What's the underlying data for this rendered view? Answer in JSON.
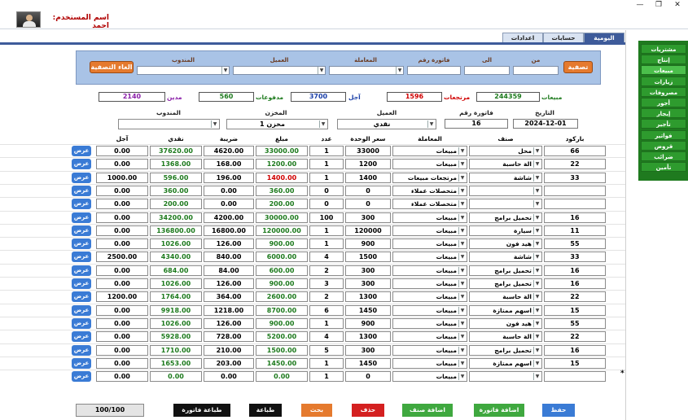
{
  "header": {
    "username_label": "اسم المستخدم: احمد"
  },
  "tabs": [
    {
      "label": "اليومية",
      "active": true
    },
    {
      "label": "حسابات",
      "active": false
    },
    {
      "label": "اعدادات",
      "active": false
    }
  ],
  "filter": {
    "filter_button": "تصفية",
    "cancel_filter_button": "الغاء التصفية",
    "labels": {
      "from": "من",
      "to": "الى",
      "invoice_no": "فاتورة رقم",
      "transaction": "المعاملة",
      "customer": "العميل",
      "agent": "المندوب"
    }
  },
  "totals": [
    {
      "label": "مبيعات",
      "value": "244359",
      "color": "#1d7a1d"
    },
    {
      "label": "مرتجعات",
      "value": "1596",
      "color": "#d00000"
    },
    {
      "label": "آجل",
      "value": "3700",
      "color": "#1a3fa8"
    },
    {
      "label": "مدفوعات",
      "value": "560",
      "color": "#1d7a1d"
    },
    {
      "label": "مدين",
      "value": "2140",
      "color": "#8a1fa8"
    }
  ],
  "invoice": {
    "date_label": "التاريخ",
    "date_value": "2024-12-01",
    "invoice_no_label": "فاتورة رقم",
    "invoice_no_value": "16",
    "customer_label": "العميل",
    "customer_value": "نقدي",
    "store_label": "المخزن",
    "store_value": "مخزن 1",
    "agent_label": "المندوب",
    "agent_value": ""
  },
  "grid": {
    "columns": {
      "barcode": "باركود",
      "item": "صنف",
      "transaction": "المعاملة",
      "unit_price": "سعر الوحدة",
      "qty": "عدد",
      "amount": "مبلغ",
      "tax": "ضريبة",
      "cash": "نقدي",
      "credit": "آجل"
    },
    "show_label": "عرض",
    "rows": [
      {
        "barcode": "66",
        "item": "محل",
        "txn": "مبيعات",
        "price": "33000",
        "qty": "1",
        "amount": "33000.00",
        "amount_color": "green",
        "tax": "4620.00",
        "cash": "37620.00",
        "cash_color": "green",
        "credit": "0.00"
      },
      {
        "barcode": "22",
        "item": "الة حاسبة",
        "txn": "مبيعات",
        "price": "1200",
        "qty": "1",
        "amount": "1200.00",
        "amount_color": "green",
        "tax": "168.00",
        "cash": "1368.00",
        "cash_color": "green",
        "credit": "0.00"
      },
      {
        "barcode": "33",
        "item": "شاشة",
        "txn": "مرتجعات مبيعات",
        "price": "1400",
        "qty": "1",
        "amount": "1400.00",
        "amount_color": "red",
        "tax": "196.00",
        "cash": "596.00",
        "cash_color": "green",
        "credit": "1000.00"
      },
      {
        "barcode": "",
        "item": "",
        "txn": "متحصلات عملاء",
        "price": "0",
        "qty": "0",
        "amount": "360.00",
        "amount_color": "green",
        "tax": "0.00",
        "cash": "360.00",
        "cash_color": "green",
        "credit": "0.00"
      },
      {
        "barcode": "",
        "item": "",
        "txn": "متحصلات عملاء",
        "price": "0",
        "qty": "0",
        "amount": "200.00",
        "amount_color": "green",
        "tax": "0.00",
        "cash": "200.00",
        "cash_color": "green",
        "credit": "0.00"
      },
      {
        "barcode": "16",
        "item": "تحميل برامج",
        "txn": "مبيعات",
        "price": "300",
        "qty": "100",
        "amount": "30000.00",
        "amount_color": "green",
        "tax": "4200.00",
        "cash": "34200.00",
        "cash_color": "green",
        "credit": "0.00"
      },
      {
        "barcode": "11",
        "item": "سيارة",
        "txn": "مبيعات",
        "price": "120000",
        "qty": "1",
        "amount": "120000.00",
        "amount_color": "green",
        "tax": "16800.00",
        "cash": "136800.00",
        "cash_color": "green",
        "credit": "0.00"
      },
      {
        "barcode": "55",
        "item": "هيد فون",
        "txn": "مبيعات",
        "price": "900",
        "qty": "1",
        "amount": "900.00",
        "amount_color": "green",
        "tax": "126.00",
        "cash": "1026.00",
        "cash_color": "green",
        "credit": "0.00"
      },
      {
        "barcode": "33",
        "item": "شاشة",
        "txn": "مبيعات",
        "price": "1500",
        "qty": "4",
        "amount": "6000.00",
        "amount_color": "green",
        "tax": "840.00",
        "cash": "4340.00",
        "cash_color": "green",
        "credit": "2500.00"
      },
      {
        "barcode": "16",
        "item": "تحميل برامج",
        "txn": "مبيعات",
        "price": "300",
        "qty": "2",
        "amount": "600.00",
        "amount_color": "green",
        "tax": "84.00",
        "cash": "684.00",
        "cash_color": "green",
        "credit": "0.00"
      },
      {
        "barcode": "16",
        "item": "تحميل برامج",
        "txn": "مبيعات",
        "price": "300",
        "qty": "3",
        "amount": "900.00",
        "amount_color": "green",
        "tax": "126.00",
        "cash": "1026.00",
        "cash_color": "green",
        "credit": "0.00"
      },
      {
        "barcode": "22",
        "item": "الة حاسبة",
        "txn": "مبيعات",
        "price": "1300",
        "qty": "2",
        "amount": "2600.00",
        "amount_color": "green",
        "tax": "364.00",
        "cash": "1764.00",
        "cash_color": "green",
        "credit": "1200.00"
      },
      {
        "barcode": "15",
        "item": "اسهم ممتازة",
        "txn": "مبيعات",
        "price": "1450",
        "qty": "6",
        "amount": "8700.00",
        "amount_color": "green",
        "tax": "1218.00",
        "cash": "9918.00",
        "cash_color": "green",
        "credit": "0.00"
      },
      {
        "barcode": "55",
        "item": "هيد فون",
        "txn": "مبيعات",
        "price": "900",
        "qty": "1",
        "amount": "900.00",
        "amount_color": "green",
        "tax": "126.00",
        "cash": "1026.00",
        "cash_color": "green",
        "credit": "0.00"
      },
      {
        "barcode": "22",
        "item": "الة حاسبة",
        "txn": "مبيعات",
        "price": "1300",
        "qty": "4",
        "amount": "5200.00",
        "amount_color": "green",
        "tax": "728.00",
        "cash": "5928.00",
        "cash_color": "green",
        "credit": "0.00"
      },
      {
        "barcode": "16",
        "item": "تحميل برامج",
        "txn": "مبيعات",
        "price": "300",
        "qty": "5",
        "amount": "1500.00",
        "amount_color": "green",
        "tax": "210.00",
        "cash": "1710.00",
        "cash_color": "green",
        "credit": "0.00"
      },
      {
        "barcode": "15",
        "item": "اسهم ممتازة",
        "txn": "مبيعات",
        "price": "1450",
        "qty": "1",
        "amount": "1450.00",
        "amount_color": "green",
        "tax": "203.00",
        "cash": "1653.00",
        "cash_color": "green",
        "credit": "0.00"
      },
      {
        "barcode": "",
        "item": "",
        "txn": "مبيعات",
        "price": "0",
        "qty": "1",
        "amount": "0.00",
        "amount_color": "green",
        "tax": "0.00",
        "cash": "0.00",
        "cash_color": "green",
        "credit": "0.00"
      }
    ]
  },
  "bottom": {
    "progress_text": "100/100",
    "buttons": [
      {
        "label": "طباعة فاتورة",
        "color": "#111111"
      },
      {
        "label": "طباعة",
        "color": "#111111"
      },
      {
        "label": "بحث",
        "color": "#e57a2e"
      },
      {
        "label": "حذف",
        "color": "#d42020"
      },
      {
        "label": "اضافة صنف",
        "color": "#3fa83f"
      },
      {
        "label": "اضافة فاتورة",
        "color": "#3fa83f"
      },
      {
        "label": "حفظ",
        "color": "#3a7bd5"
      }
    ]
  },
  "sidebar": {
    "items": [
      {
        "label": "مشتريات",
        "active": false
      },
      {
        "label": "إنتاج",
        "active": false
      },
      {
        "label": "مبيعات",
        "active": true
      },
      {
        "label": "زيارات",
        "active": false
      },
      {
        "label": "مصروفات",
        "active": false
      },
      {
        "label": "أجور",
        "active": false
      },
      {
        "label": "إيجار",
        "active": false
      },
      {
        "label": "تأجير",
        "active": false
      },
      {
        "label": "فواتير",
        "active": false
      },
      {
        "label": "قروض",
        "active": false
      },
      {
        "label": "ضرائب",
        "active": false
      },
      {
        "label": "تأمين",
        "active": false
      }
    ]
  },
  "window": {
    "minimize_glyph": "—",
    "restore_glyph": "❐",
    "close_glyph": "✕"
  },
  "row_marker": "*"
}
